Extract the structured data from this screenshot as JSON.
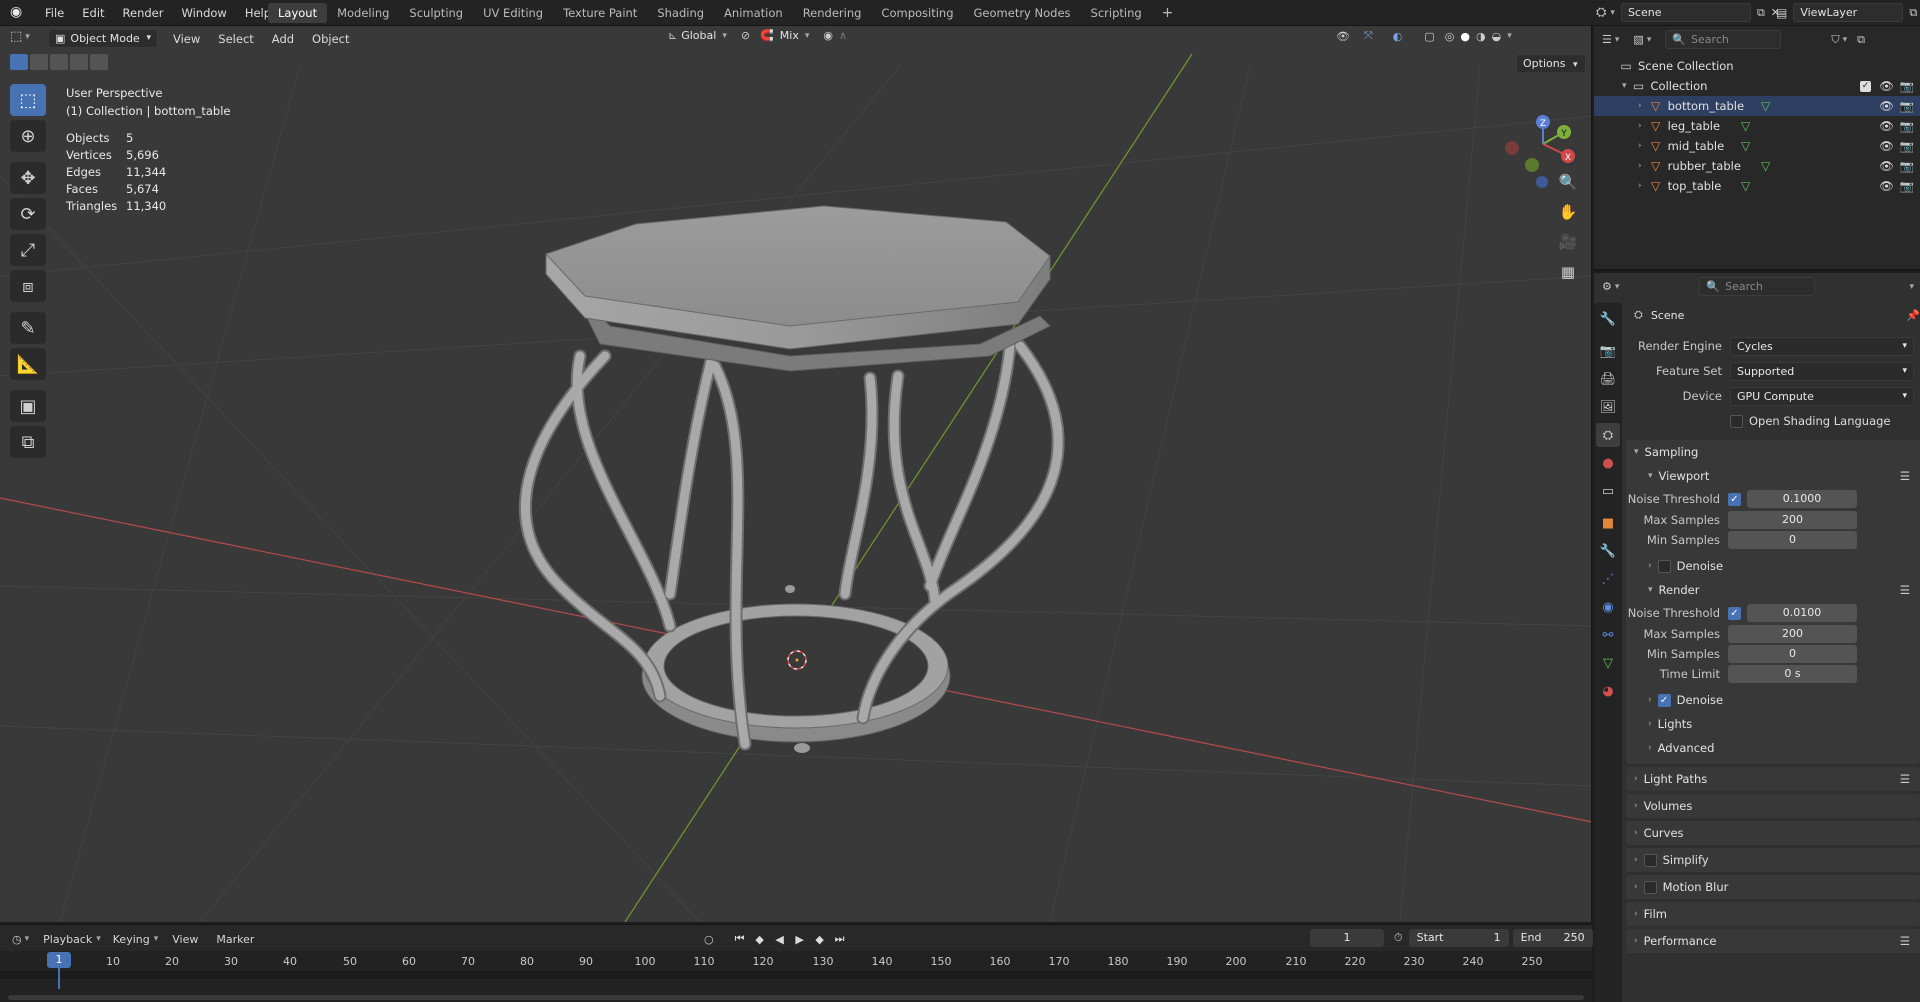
{
  "topbar": {
    "menus": [
      "File",
      "Edit",
      "Render",
      "Window",
      "Help"
    ],
    "workspaces": [
      "Layout",
      "Modeling",
      "Sculpting",
      "UV Editing",
      "Texture Paint",
      "Shading",
      "Animation",
      "Rendering",
      "Compositing",
      "Geometry Nodes",
      "Scripting"
    ],
    "active_workspace": "Layout",
    "add_workspace": "+",
    "scene": "Scene",
    "view_layer": "ViewLayer"
  },
  "viewport": {
    "mode": "Object Mode",
    "menus": [
      "View",
      "Select",
      "Add",
      "Object"
    ],
    "transform_orientation": "Global",
    "snap_mode": "Mix",
    "options_label": "Options",
    "overlay_title": "User Perspective",
    "overlay_subtitle": "(1) Collection | bottom_table",
    "stats": [
      {
        "label": "Objects",
        "value": "5"
      },
      {
        "label": "Vertices",
        "value": "5,696"
      },
      {
        "label": "Edges",
        "value": "11,344"
      },
      {
        "label": "Faces",
        "value": "5,674"
      },
      {
        "label": "Triangles",
        "value": "11,340"
      }
    ],
    "gizmo": {
      "x": "X",
      "y": "Y",
      "z": "Z"
    }
  },
  "outliner": {
    "search_placeholder": "Search",
    "scene_collection": "Scene Collection",
    "collection": "Collection",
    "objects": [
      "bottom_table",
      "leg_table",
      "mid_table",
      "rubber_table",
      "top_table"
    ]
  },
  "properties": {
    "search_placeholder": "Search",
    "context": "Scene",
    "render_engine_label": "Render Engine",
    "render_engine": "Cycles",
    "feature_set_label": "Feature Set",
    "feature_set": "Supported",
    "device_label": "Device",
    "device": "GPU Compute",
    "osl_label": "Open Shading Language",
    "sampling": "Sampling",
    "viewport_panel": "Viewport",
    "render_panel": "Render",
    "noise_threshold_label": "Noise Threshold",
    "viewport_noise_threshold": "0.1000",
    "max_samples_label": "Max Samples",
    "viewport_max_samples": "200",
    "min_samples_label": "Min Samples",
    "viewport_min_samples": "0",
    "denoise_label": "Denoise",
    "render_noise_threshold": "0.0100",
    "render_max_samples": "200",
    "render_min_samples": "0",
    "time_limit_label": "Time Limit",
    "time_limit": "0 s",
    "lights": "Lights",
    "advanced": "Advanced",
    "light_paths": "Light Paths",
    "volumes": "Volumes",
    "curves": "Curves",
    "simplify": "Simplify",
    "motion_blur": "Motion Blur",
    "film": "Film",
    "performance": "Performance"
  },
  "timeline": {
    "menus": [
      "Playback",
      "Keying",
      "View",
      "Marker"
    ],
    "current_frame": "1",
    "start_label": "Start",
    "start": "1",
    "end_label": "End",
    "end": "250",
    "ruler": [
      "1",
      "10",
      "20",
      "30",
      "40",
      "50",
      "60",
      "70",
      "80",
      "90",
      "100",
      "110",
      "120",
      "130",
      "140",
      "150",
      "160",
      "170",
      "180",
      "190",
      "200",
      "210",
      "220",
      "230",
      "240",
      "250"
    ]
  },
  "colors": {
    "accent": "#4772b3",
    "x_axis": "#b84a4a",
    "y_axis": "#6e9a2e",
    "object_icon": "#e2873a",
    "mesh_icon": "#5fc15f"
  }
}
